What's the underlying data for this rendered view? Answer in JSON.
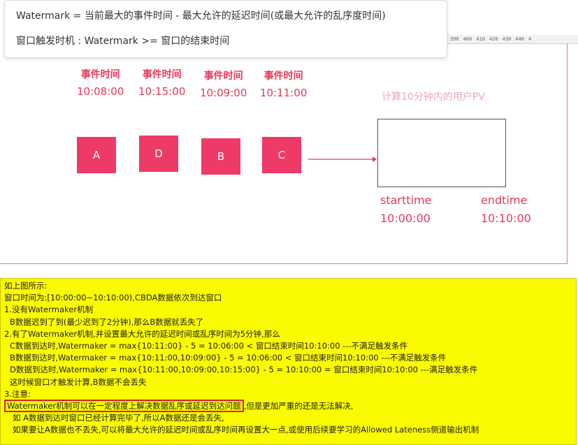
{
  "tooltip": {
    "line1": "Watermark = 当前最大的事件时间 -  最大允许的延迟时间(或最大允许的乱序度时间)",
    "line2": "窗口触发时机 : Watermark >= 窗口的结束时间"
  },
  "ruler": [
    "390",
    "400",
    "410",
    "420",
    "430",
    "440",
    "4"
  ],
  "events": [
    {
      "label": "事件时间",
      "time": "10:08:00",
      "box": "A"
    },
    {
      "label": "事件时间",
      "time": "10:15:00",
      "box": "D"
    },
    {
      "label": "事件时间",
      "time": "10:09:00",
      "box": "B"
    },
    {
      "label": "事件时间",
      "time": "10:11:00",
      "box": "C"
    }
  ],
  "window": {
    "pv_label": "计算10分钟内的用户PV",
    "start_label": "starttime",
    "start_time": "10:00:00",
    "end_label": "endtime",
    "end_time": "10:10:00"
  },
  "note": {
    "l1": "如上图所示:",
    "l2": "窗口时间为:[10:00:00~10:10:00),CBDA数据依次到达窗口",
    "l3": "1.没有Watermaker机制",
    "l4": "B数据迟到了到(最少迟到了2分钟),那么B数据就丢失了",
    "l5": "2.有了Watermaker机制,并设置最大允许的延迟时间或乱序时间为5分钟,那么",
    "l6": "C数据到达时,Watermaker = max{10:11:00} - 5 = 10:06:00 < 窗口结束时间10:10:00 ---不满足触发条件",
    "l7": "B数据到达时,Watermaker = max{10:11:00,10:09:00} - 5 = 10:06:00 < 窗口结束时间10:10:00 ---不满足触发条件",
    "l8": "D数据到达时,Watermaker = max{10:11:00,10:09:00,10:15:00} - 5 = 10:10:00 = 窗口结束时间10:10:00 ---满足触发条件",
    "l9": "这时候窗口才触发计算,B数据不会丢失",
    "l10": "3.注意:",
    "l11_hl": "Watermaker机制可以在一定程度上解决数据乱序或延迟到达问题",
    "l11_rest": ",但是更加严重的还是无法解决,",
    "l12": "如 A数据到达时窗口已经计算完毕了,所以A数据还是会丢失,",
    "l13": "如果要让A数据也不丢失,可以将最大允许的延迟时间或乱序时间再设置大一点,或使用后续要学习的Allowed Lateness侧道输出机制"
  },
  "colors": {
    "accent": "#e8385a",
    "box": "#ee3a66",
    "note_bg": "#fafa00",
    "highlight": "#e02020"
  }
}
